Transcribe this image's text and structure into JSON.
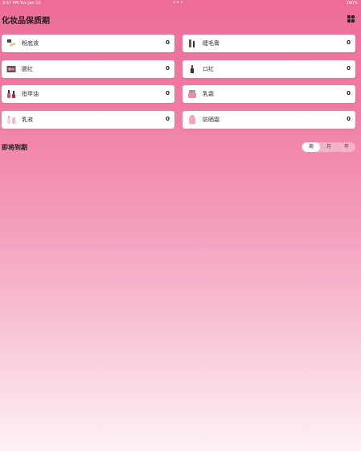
{
  "status": {
    "time": "9:57 PM   Tue Jan 10",
    "dots": "•••",
    "battery": "100%"
  },
  "app": {
    "title": "化妆品保质期"
  },
  "cards": [
    {
      "label": "粉底液",
      "count": "0",
      "icon": "foundation-icon"
    },
    {
      "label": "睫毛膏",
      "count": "0",
      "icon": "mascara-icon"
    },
    {
      "label": "腮红",
      "count": "0",
      "icon": "blush-icon"
    },
    {
      "label": "口红",
      "count": "0",
      "icon": "lipstick-icon"
    },
    {
      "label": "指甲油",
      "count": "0",
      "icon": "nail-polish-icon"
    },
    {
      "label": "乳霜",
      "count": "0",
      "icon": "cream-jar-icon"
    },
    {
      "label": "乳液",
      "count": "0",
      "icon": "lotion-icon"
    },
    {
      "label": "防晒霜",
      "count": "0",
      "icon": "sunscreen-icon"
    }
  ],
  "expiring": {
    "title": "即将到期",
    "segments": [
      "周",
      "月",
      "年"
    ],
    "selected": "周"
  },
  "colors": {
    "gradient_top": "#ee6c98",
    "gradient_bottom": "#fdf1f5",
    "card": "#ffffff"
  }
}
